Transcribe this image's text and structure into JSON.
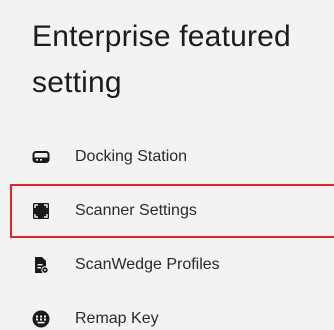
{
  "header": {
    "title": "Enterprise featured setting"
  },
  "menu": {
    "items": [
      {
        "label": "Docking Station",
        "icon": "docking-station-icon"
      },
      {
        "label": "Scanner Settings",
        "icon": "scanner-icon"
      },
      {
        "label": "ScanWedge Profiles",
        "icon": "scanwedge-profile-icon"
      },
      {
        "label": "Remap Key",
        "icon": "keyboard-icon"
      }
    ]
  },
  "colors": {
    "background": "#f3f3f3",
    "highlight_border": "#e0242b",
    "text": "#2a2a2a"
  }
}
